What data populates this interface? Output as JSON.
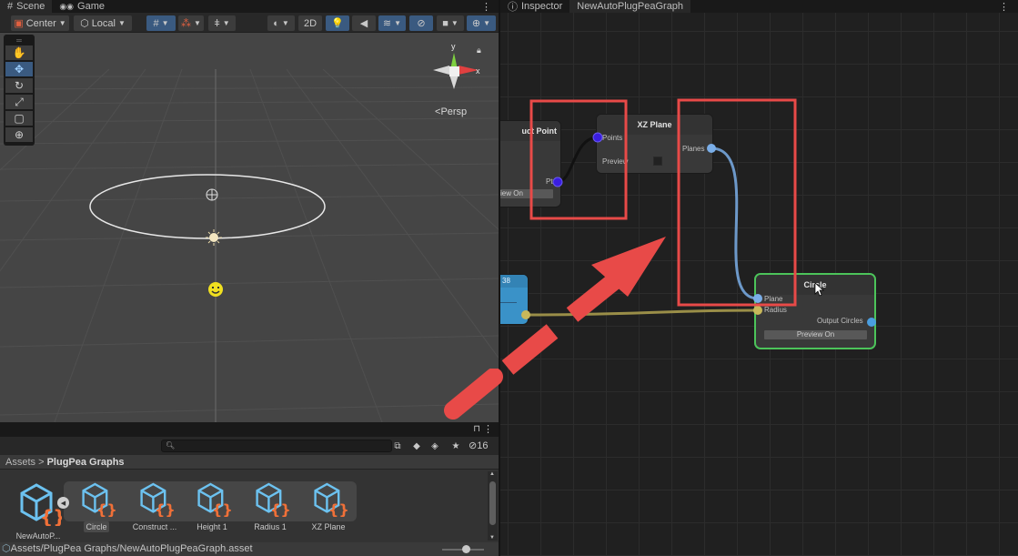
{
  "scene_panel": {
    "tabs": [
      {
        "label": "Scene",
        "icon": "grid-hash-icon",
        "active": true
      },
      {
        "label": "Game",
        "icon": "gamepad-icon",
        "active": false
      }
    ],
    "toolbar": {
      "pivot_label": "Center",
      "space_label": "Local",
      "mode_2d_label": "2D"
    },
    "tools": [
      "hand-tool",
      "move-tool",
      "rotate-tool",
      "scale-tool",
      "rect-tool",
      "transform-tool"
    ],
    "active_tool": "move-tool",
    "gizmo": {
      "x_label": "x",
      "y_label": "y",
      "projection_label": "Persp"
    }
  },
  "project_panel": {
    "search_placeholder": "",
    "hidden_count": "16",
    "breadcrumb": {
      "root": "Assets",
      "separator": ">",
      "current": "PlugPea Graphs"
    },
    "assets": [
      {
        "label": "NewAutoP...",
        "selected": false
      },
      {
        "label": "Circle",
        "selected": true
      },
      {
        "label": "Construct ...",
        "selected": false
      },
      {
        "label": "Height 1",
        "selected": false
      },
      {
        "label": "Radius 1",
        "selected": false
      },
      {
        "label": "XZ Plane",
        "selected": false
      }
    ],
    "status_path": "Assets/PlugPea Graphs/NewAutoPlugPeaGraph.asset"
  },
  "graph_panel": {
    "tabs": [
      {
        "label": "Inspector",
        "icon": "info-icon",
        "active": false
      },
      {
        "label": "NewAutoPlugPeaGraph",
        "active": true
      }
    ],
    "nodes": {
      "construct_point": {
        "title": "uct Point",
        "output_port": "Pt",
        "preview_label": "iew On"
      },
      "xz_plane": {
        "title": "XZ Plane",
        "input_port": "Points",
        "output_port": "Planes",
        "preview_label": "Preview"
      },
      "height": {
        "title": "38"
      },
      "circle": {
        "title": "Circle",
        "inputs": [
          "Plane",
          "Radius"
        ],
        "output_port": "Output Circles",
        "preview_label": "Preview On"
      }
    },
    "colors": {
      "point_port": "#3a1ee0",
      "plane_port": "#7aaee8",
      "radius_port": "#c8b85a",
      "selected_outline": "#4cc45a",
      "annotation_red": "#e84a48",
      "height_node": "#3a92c8"
    }
  }
}
